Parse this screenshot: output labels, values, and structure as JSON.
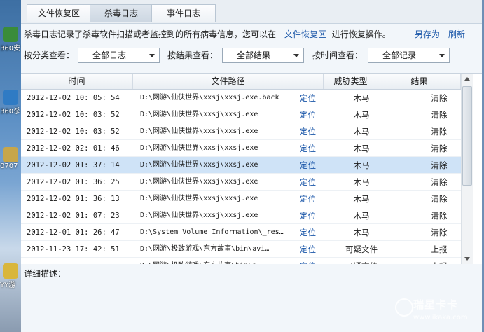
{
  "tabs": [
    {
      "label": "文件恢复区"
    },
    {
      "label": "杀毒日志"
    },
    {
      "label": "事件日志"
    }
  ],
  "info": {
    "text": "杀毒日志记录了杀毒软件扫描或者监控到的所有病毒信息，您可以在",
    "link": "文件恢复区",
    "suffix": "进行恢复操作。",
    "save_as": "另存为",
    "refresh": "刷新"
  },
  "filters": {
    "category_label": "按分类查看：",
    "category_value": "全部日志",
    "result_label": "按结果查看：",
    "result_value": "全部结果",
    "time_label": "按时间查看：",
    "time_value": "全部记录"
  },
  "table": {
    "headers": [
      "时间",
      "文件路径",
      "威胁类型",
      "结果"
    ],
    "rows": [
      {
        "time": "2012-12-02 10: 05: 54",
        "path": "D:\\网游\\仙侠世界\\xxsj\\xxsj.exe.back",
        "locate": "定位",
        "threat": "木马",
        "result": "清除"
      },
      {
        "time": "2012-12-02 10: 03: 52",
        "path": "D:\\网游\\仙侠世界\\xxsj\\xxsj.exe",
        "locate": "定位",
        "threat": "木马",
        "result": "清除"
      },
      {
        "time": "2012-12-02 10: 03: 52",
        "path": "D:\\网游\\仙侠世界\\xxsj\\xxsj.exe",
        "locate": "定位",
        "threat": "木马",
        "result": "清除"
      },
      {
        "time": "2012-12-02 02: 01: 46",
        "path": "D:\\网游\\仙侠世界\\xxsj\\xxsj.exe",
        "locate": "定位",
        "threat": "木马",
        "result": "清除"
      },
      {
        "time": "2012-12-02 01: 37: 14",
        "path": "D:\\网游\\仙侠世界\\xxsj\\xxsj.exe",
        "locate": "定位",
        "threat": "木马",
        "result": "清除"
      },
      {
        "time": "2012-12-02 01: 36: 25",
        "path": "D:\\网游\\仙侠世界\\xxsj\\xxsj.exe",
        "locate": "定位",
        "threat": "木马",
        "result": "清除"
      },
      {
        "time": "2012-12-02 01: 36: 13",
        "path": "D:\\网游\\仙侠世界\\xxsj\\xxsj.exe",
        "locate": "定位",
        "threat": "木马",
        "result": "清除"
      },
      {
        "time": "2012-12-02 01: 07: 23",
        "path": "D:\\网游\\仙侠世界\\xxsj\\xxsj.exe",
        "locate": "定位",
        "threat": "木马",
        "result": "清除"
      },
      {
        "time": "2012-12-01 01: 26: 47",
        "path": "D:\\System Volume Information\\_res…",
        "locate": "定位",
        "threat": "木马",
        "result": "清除"
      },
      {
        "time": "2012-11-23 17: 42: 51",
        "path": "D:\\网游\\极致游戏\\东方故事\\bin\\avi…",
        "locate": "定位",
        "threat": "可疑文件",
        "result": "上报"
      },
      {
        "time": "",
        "path": "D:\\网游\\极致游戏\\东方故事\\bin\\a…",
        "locate": "定位",
        "threat": "可疑文件",
        "result": "上报"
      }
    ],
    "selected_index": 4
  },
  "detail": {
    "label": "详细描述："
  },
  "desktop": {
    "icons": [
      {
        "label": "360安"
      },
      {
        "label": "360杀"
      },
      {
        "label": "0707"
      },
      {
        "label": "YY游"
      }
    ]
  },
  "watermark": {
    "name": "瑞星卡卡",
    "url": "www.ikaka.com"
  },
  "colors": {
    "accent_link": "#1a56a8",
    "selected_row": "#cfe3f7",
    "window_bg": "#f2f6fa"
  }
}
